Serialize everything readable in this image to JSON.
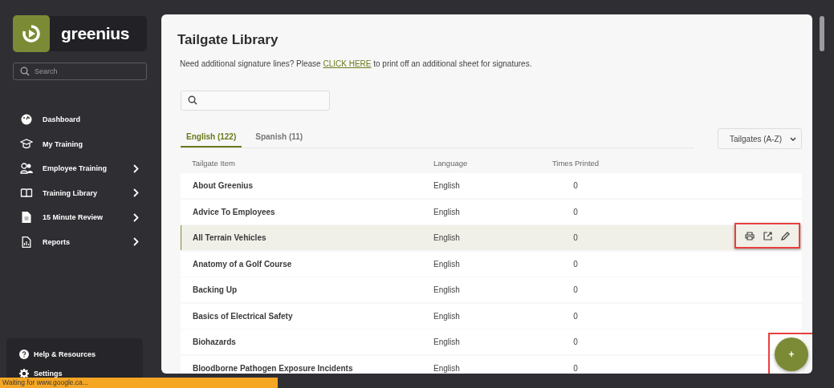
{
  "logo": {
    "name": "greenius"
  },
  "sidebar": {
    "search": {
      "placeholder": "Search"
    },
    "items": [
      {
        "label": "Dashboard",
        "has_submenu": false
      },
      {
        "label": "My Training",
        "has_submenu": false
      },
      {
        "label": "Employee Training",
        "has_submenu": true
      },
      {
        "label": "Training Library",
        "has_submenu": true
      },
      {
        "label": "15 Minute Review",
        "has_submenu": true
      },
      {
        "label": "Reports",
        "has_submenu": true
      }
    ],
    "footer_items": [
      {
        "label": "Help & Resources"
      },
      {
        "label": "Settings"
      }
    ]
  },
  "page": {
    "title": "Tailgate Library",
    "notice": {
      "before": "Need additional signature lines? Please ",
      "link": "CLICK HERE",
      "after": " to print off an additional sheet for signatures."
    },
    "tabs": [
      {
        "label": "English (122)",
        "selected": true
      },
      {
        "label": "Spanish (11)",
        "selected": false
      }
    ],
    "sort": {
      "value": "Tailgates (A-Z)"
    },
    "table": {
      "columns": [
        "Tailgate Item",
        "Language",
        "Times Printed"
      ],
      "rows": [
        {
          "cells": [
            "About Greenius",
            "English",
            "0"
          ],
          "selected": false
        },
        {
          "cells": [
            "Advice To Employees",
            "English",
            "0"
          ],
          "selected": false
        },
        {
          "cells": [
            "All Terrain Vehicles",
            "English",
            "0"
          ],
          "selected": true
        },
        {
          "cells": [
            "Anatomy of a Golf Course",
            "English",
            "0"
          ],
          "selected": false
        },
        {
          "cells": [
            "Backing Up",
            "English",
            "0"
          ],
          "selected": false
        },
        {
          "cells": [
            "Basics of Electrical Safety",
            "English",
            "0"
          ],
          "selected": false
        },
        {
          "cells": [
            "Biohazards",
            "English",
            "0"
          ],
          "selected": false
        },
        {
          "cells": [
            "Bloodborne Pathogen Exposure Incidents",
            "English",
            "0"
          ],
          "selected": false
        }
      ]
    },
    "add_button": {
      "label": "+"
    }
  },
  "status_bar": {
    "text": "Waiting for www.google.ca..."
  }
}
